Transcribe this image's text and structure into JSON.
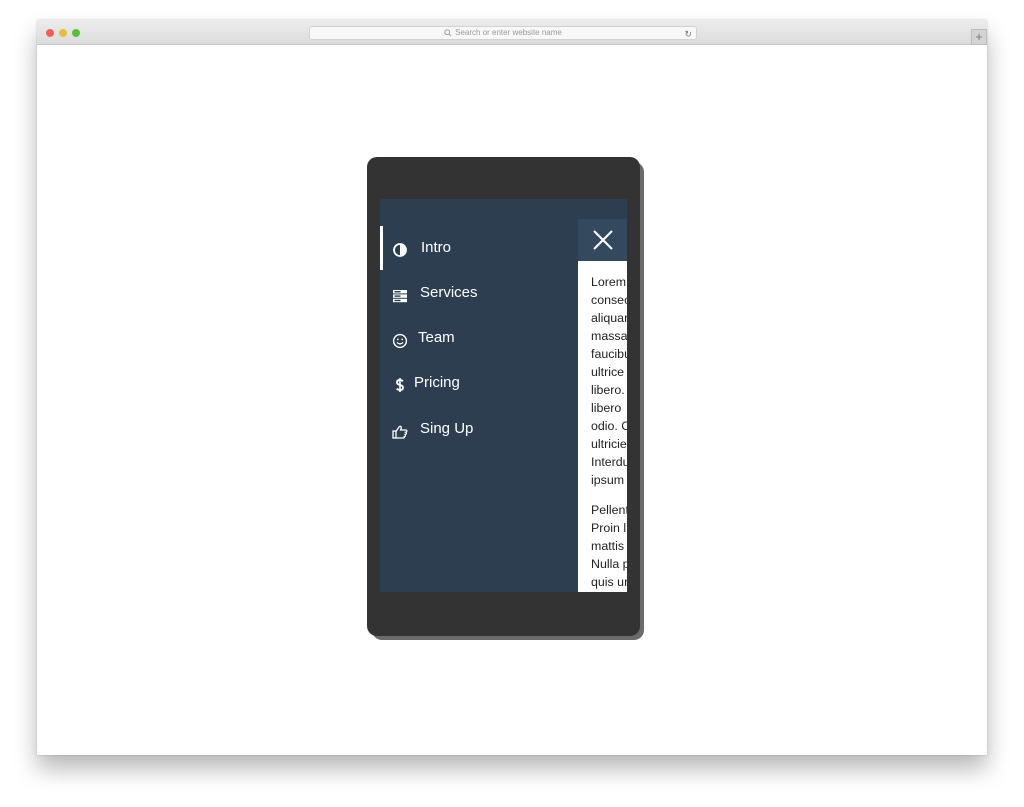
{
  "browser": {
    "address_placeholder": "Search or enter website name",
    "new_tab_label": "+",
    "reload_glyph": "↻"
  },
  "menu": {
    "items": [
      {
        "label": "Intro",
        "icon": "half-circle-icon",
        "active": true
      },
      {
        "label": "Services",
        "icon": "server-icon",
        "active": false
      },
      {
        "label": "Team",
        "icon": "smiley-icon",
        "active": false
      },
      {
        "label": "Pricing",
        "icon": "dollar-icon",
        "active": false
      },
      {
        "label": "Sing Up",
        "icon": "thumbs-up-icon",
        "active": false
      }
    ]
  },
  "content": {
    "paragraph1": [
      "Lorem",
      "consec",
      "aliquar",
      "massa",
      "faucibu",
      "ultrice",
      "libero.",
      "libero",
      "odio. C",
      "ultricie",
      "Interdu",
      "ipsum"
    ],
    "paragraph2": [
      "Pellent",
      "Proin l",
      "mattis",
      "Nulla p",
      "quis ur"
    ]
  },
  "colors": {
    "menu_bg": "#2c3e50",
    "close_bg": "#34495e",
    "phone_frame": "#333333",
    "text_light": "#ffffff"
  }
}
